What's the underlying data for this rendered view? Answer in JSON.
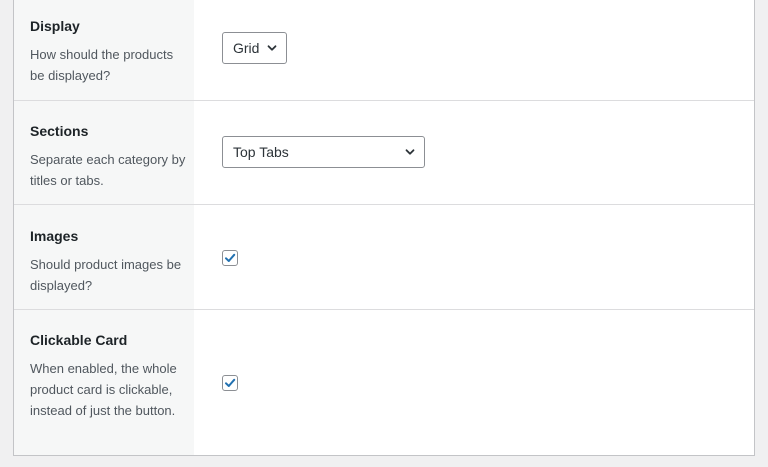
{
  "settings": {
    "display": {
      "title": "Display",
      "description": "How should the products be displayed?",
      "value": "Grid"
    },
    "sections": {
      "title": "Sections",
      "description": "Separate each category by titles or tabs.",
      "value": "Top Tabs"
    },
    "images": {
      "title": "Images",
      "description": "Should product images be displayed?",
      "checked": true
    },
    "clickable_card": {
      "title": "Clickable Card",
      "description": "When enabled, the whole product card is clickable, instead of just the button.",
      "checked": true
    }
  },
  "colors": {
    "accent": "#2271b1",
    "label_background": "#f6f7f7",
    "page_background": "#f0f0f1"
  },
  "icons": {
    "select_arrow": "chevron-down-icon",
    "checkbox_mark": "checkmark-icon"
  }
}
